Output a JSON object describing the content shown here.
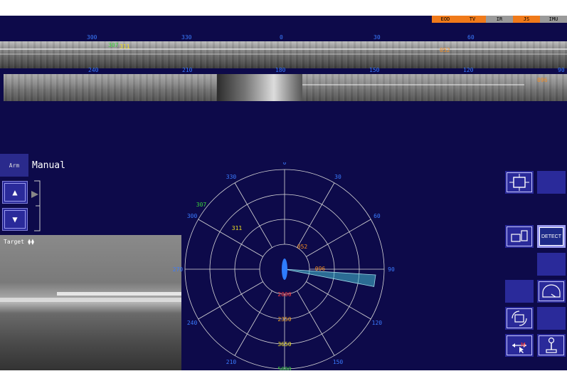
{
  "mode_tabs": [
    {
      "label": "EOD",
      "color": "#f07a1a"
    },
    {
      "label": "TV",
      "color": "#f07a1a"
    },
    {
      "label": "IR",
      "color": "#9a9a9a"
    },
    {
      "label": "JS",
      "color": "#f07a1a"
    },
    {
      "label": "IMU",
      "color": "#9a9a9a"
    }
  ],
  "strip1": {
    "ticks": [
      "300",
      "330",
      "0",
      "30",
      "60"
    ],
    "targets": [
      {
        "label": "307",
        "color": "#3ad43a"
      },
      {
        "label": "311",
        "color": "#f0e020"
      },
      {
        "label": "052",
        "color": "#f08a20"
      }
    ]
  },
  "strip2": {
    "ticks": [
      "240",
      "210",
      "180",
      "150",
      "120",
      "90"
    ],
    "targets": [
      {
        "label": "096",
        "color": "#f08a20"
      }
    ]
  },
  "controls": {
    "arm_label": "Arm",
    "mode_label": "Manual",
    "up_glyph": "▲",
    "down_glyph": "▼"
  },
  "tv_view": {
    "label": "Target ⧫⧫"
  },
  "radar": {
    "bearings": [
      "0",
      "30",
      "60",
      "90",
      "120",
      "150",
      "180",
      "210",
      "240",
      "270",
      "300",
      "330"
    ],
    "ranges": [
      "2000",
      "2350",
      "3650",
      "5000"
    ],
    "range_colors": [
      "#ff3a3a",
      "#f0a020",
      "#f0e020",
      "#3ad43a"
    ],
    "targets": [
      {
        "label": "307",
        "color": "#3ad43a"
      },
      {
        "label": "311",
        "color": "#f0e020"
      },
      {
        "label": "052",
        "color": "#f08a20"
      },
      {
        "label": "096",
        "color": "#f08a20"
      }
    ],
    "accent": "#3a7bff"
  },
  "right_panel": {
    "detect_label": "DETECT"
  }
}
